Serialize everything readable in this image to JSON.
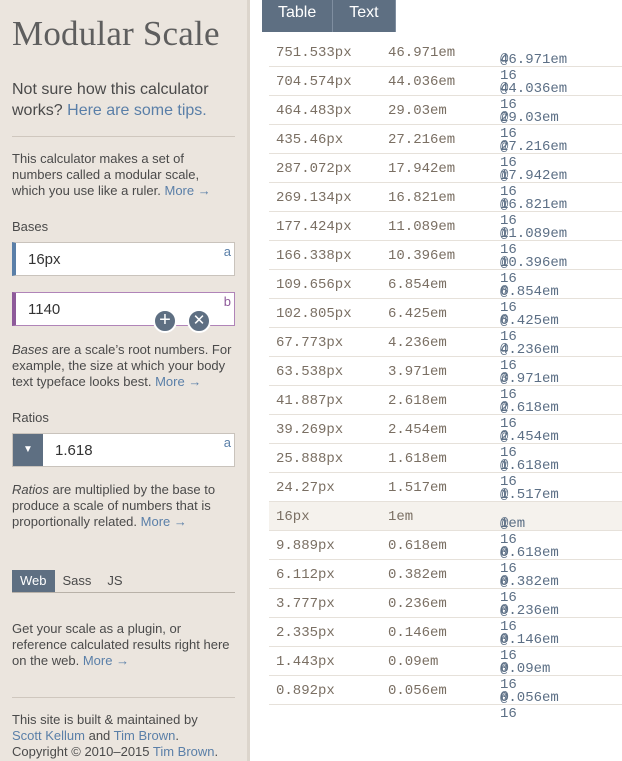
{
  "sidebar": {
    "title": "Modular Scale",
    "intro_text": "Not sure how this calculator works?",
    "intro_link": "Here are some tips.",
    "desc": "This calculator makes a set of numbers called a modular scale, which you use like a ruler.",
    "more": "More →",
    "bases_label": "Bases",
    "base_a_value": "16px",
    "base_a_tag": "a",
    "base_b_value": "1140",
    "base_b_tag": "b",
    "add_symbol": "+",
    "remove_symbol": "✕",
    "bases_desc_em": "Bases",
    "bases_desc": " are a scale’s root numbers. For example, the size at which your body text typeface looks best.",
    "ratios_label": "Ratios",
    "ratio_value": "1.618",
    "ratio_tag": "a",
    "ratios_desc_em": "Ratios",
    "ratios_desc": " are multiplied by the base to produce a scale of numbers that is proportionally related.",
    "export_tabs": [
      "Web",
      "Sass",
      "JS"
    ],
    "export_desc": "Get your scale as a plugin, or reference calculated results right here on the web.",
    "footer_1": "This site is built & maintained by",
    "author_1": "Scott Kellum",
    "and": " and ",
    "author_2": "Tim Brown",
    "period": ".",
    "copyright": "Copyright © 2010–2015 ",
    "author_3": "Tim Brown"
  },
  "tabs": [
    "Table",
    "Text"
  ],
  "rows": [
    {
      "px": "751.533px",
      "em": "46.971em",
      "em16": "46.971em",
      "suffix": " @ 16"
    },
    {
      "px": "704.574px",
      "em": "44.036em",
      "em16": "44.036em",
      "suffix": " @ 16"
    },
    {
      "px": "464.483px",
      "em": "29.03em",
      "em16": "29.03em",
      "suffix": " @ 16"
    },
    {
      "px": "435.46px",
      "em": "27.216em",
      "em16": "27.216em",
      "suffix": " @ 16"
    },
    {
      "px": "287.072px",
      "em": "17.942em",
      "em16": "17.942em",
      "suffix": " @ 16"
    },
    {
      "px": "269.134px",
      "em": "16.821em",
      "em16": "16.821em",
      "suffix": " @ 16"
    },
    {
      "px": "177.424px",
      "em": "11.089em",
      "em16": "11.089em",
      "suffix": " @ 16"
    },
    {
      "px": "166.338px",
      "em": "10.396em",
      "em16": "10.396em",
      "suffix": " @ 16"
    },
    {
      "px": "109.656px",
      "em": "6.854em",
      "em16": "6.854em",
      "suffix": " @ 16"
    },
    {
      "px": "102.805px",
      "em": "6.425em",
      "em16": "6.425em",
      "suffix": " @ 16"
    },
    {
      "px": "67.773px",
      "em": "4.236em",
      "em16": "4.236em",
      "suffix": " @ 16"
    },
    {
      "px": "63.538px",
      "em": "3.971em",
      "em16": "3.971em",
      "suffix": " @ 16"
    },
    {
      "px": "41.887px",
      "em": "2.618em",
      "em16": "2.618em",
      "suffix": " @ 16"
    },
    {
      "px": "39.269px",
      "em": "2.454em",
      "em16": "2.454em",
      "suffix": " @ 16"
    },
    {
      "px": "25.888px",
      "em": "1.618em",
      "em16": "1.618em",
      "suffix": " @ 16"
    },
    {
      "px": "24.27px",
      "em": "1.517em",
      "em16": "1.517em",
      "suffix": " @ 16"
    },
    {
      "px": "16px",
      "em": "1em",
      "em16": "1em",
      "suffix": " @ 16",
      "base": true
    },
    {
      "px": "9.889px",
      "em": "0.618em",
      "em16": "0.618em",
      "suffix": " @ 16"
    },
    {
      "px": "6.112px",
      "em": "0.382em",
      "em16": "0.382em",
      "suffix": " @ 16"
    },
    {
      "px": "3.777px",
      "em": "0.236em",
      "em16": "0.236em",
      "suffix": " @ 16"
    },
    {
      "px": "2.335px",
      "em": "0.146em",
      "em16": "0.146em",
      "suffix": " @ 16"
    },
    {
      "px": "1.443px",
      "em": "0.09em",
      "em16": "0.09em",
      "suffix": " @ 16"
    },
    {
      "px": "0.892px",
      "em": "0.056em",
      "em16": "0.056em",
      "suffix": " @ 16"
    }
  ]
}
